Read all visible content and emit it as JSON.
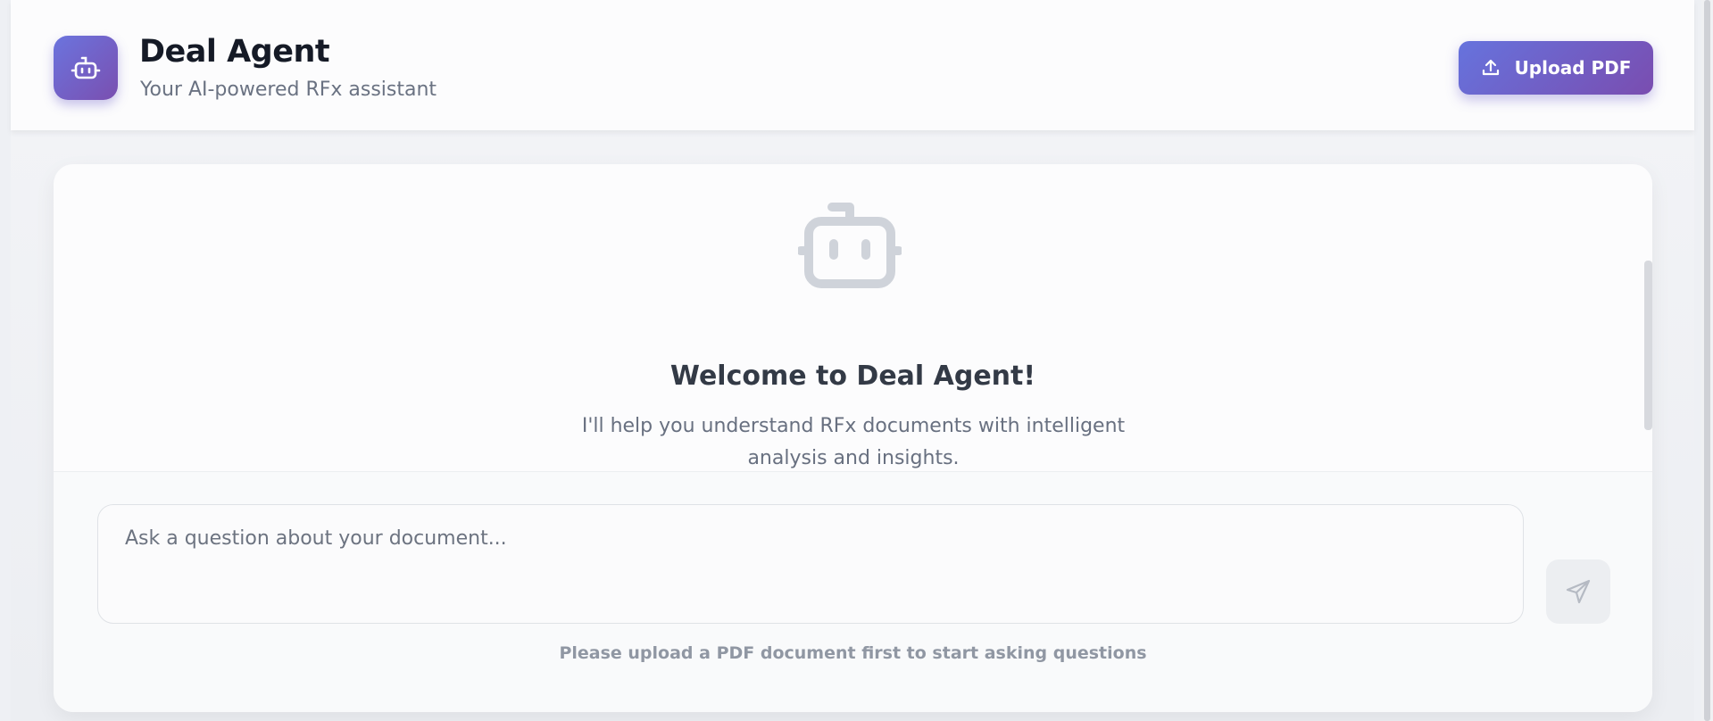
{
  "header": {
    "title": "Deal Agent",
    "subtitle": "Your AI-powered RFx assistant",
    "logo_icon": "robot-icon",
    "upload_label": "Upload PDF",
    "upload_icon": "upload-icon"
  },
  "welcome": {
    "icon": "robot-icon",
    "title": "Welcome to Deal Agent!",
    "text": "I'll help you understand RFx documents with intelligent analysis and insights."
  },
  "composer": {
    "placeholder": "Ask a question about your document...",
    "send_icon": "send-icon",
    "hint": "Please upload a PDF document first to start asking questions"
  },
  "colors": {
    "accent_start": "#6673dd",
    "accent_end": "#7a4db0",
    "icon_muted": "#cfd3da"
  }
}
